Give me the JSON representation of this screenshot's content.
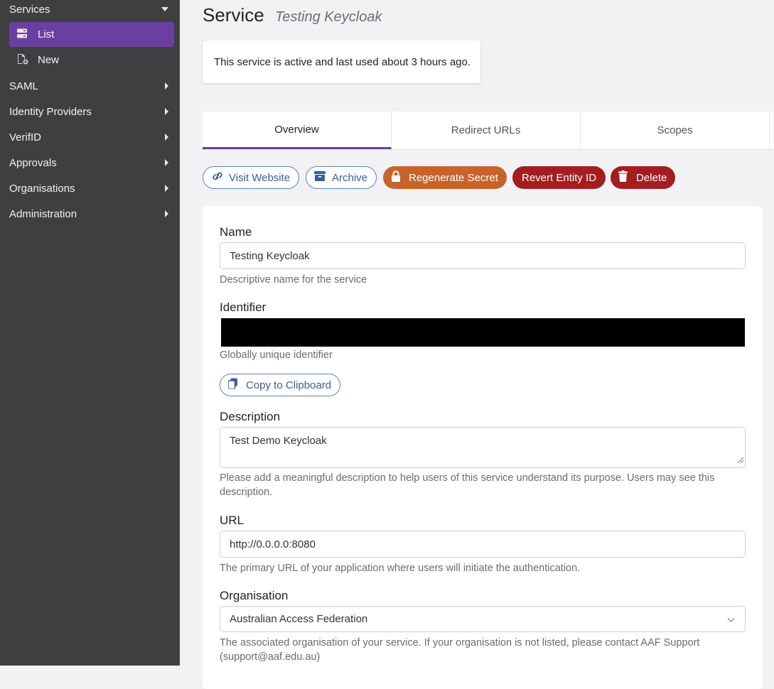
{
  "sidebar": {
    "services": {
      "label": "Services",
      "items": [
        {
          "label": "List",
          "icon": "server-icon",
          "active": true
        },
        {
          "label": "New",
          "icon": "new-document-icon",
          "active": false
        }
      ]
    },
    "sections": [
      {
        "label": "SAML"
      },
      {
        "label": "Identity Providers"
      },
      {
        "label": "VerifID"
      },
      {
        "label": "Approvals"
      },
      {
        "label": "Organisations"
      },
      {
        "label": "Administration"
      }
    ]
  },
  "header": {
    "title": "Service",
    "subtitle": "Testing Keycloak"
  },
  "status": {
    "text": "This service is active and last used about 3 hours ago."
  },
  "tabs": [
    {
      "label": "Overview",
      "active": true
    },
    {
      "label": "Redirect URLs",
      "active": false
    },
    {
      "label": "Scopes",
      "active": false
    }
  ],
  "actions": {
    "visit_website": "Visit Website",
    "archive": "Archive",
    "regenerate_secret": "Regenerate Secret",
    "revert_entity_id": "Revert Entity ID",
    "delete": "Delete"
  },
  "form": {
    "name": {
      "label": "Name",
      "value": "Testing Keycloak",
      "help": "Descriptive name for the service"
    },
    "identifier": {
      "label": "Identifier",
      "help": "Globally unique identifier",
      "copy_label": "Copy to Clipboard"
    },
    "description": {
      "label": "Description",
      "value": "Test Demo Keycloak",
      "help": "Please add a meaningful description to help users of this service understand its purpose. Users may see this description."
    },
    "url": {
      "label": "URL",
      "value": "http://0.0.0.0:8080",
      "help": "The primary URL of your application where users will initiate the authentication."
    },
    "organisation": {
      "label": "Organisation",
      "value": "Australian Access Federation",
      "help": "The associated organisation of your service. If your organisation is not listed, please contact AAF Support (support@aaf.edu.au)"
    }
  },
  "colors": {
    "sidebar_bg": "#3f3f42",
    "accent_purple": "#6b3fa0",
    "outline_blue": "#5f84b5",
    "warning_orange": "#c8632a",
    "danger_red": "#a41d1f"
  }
}
